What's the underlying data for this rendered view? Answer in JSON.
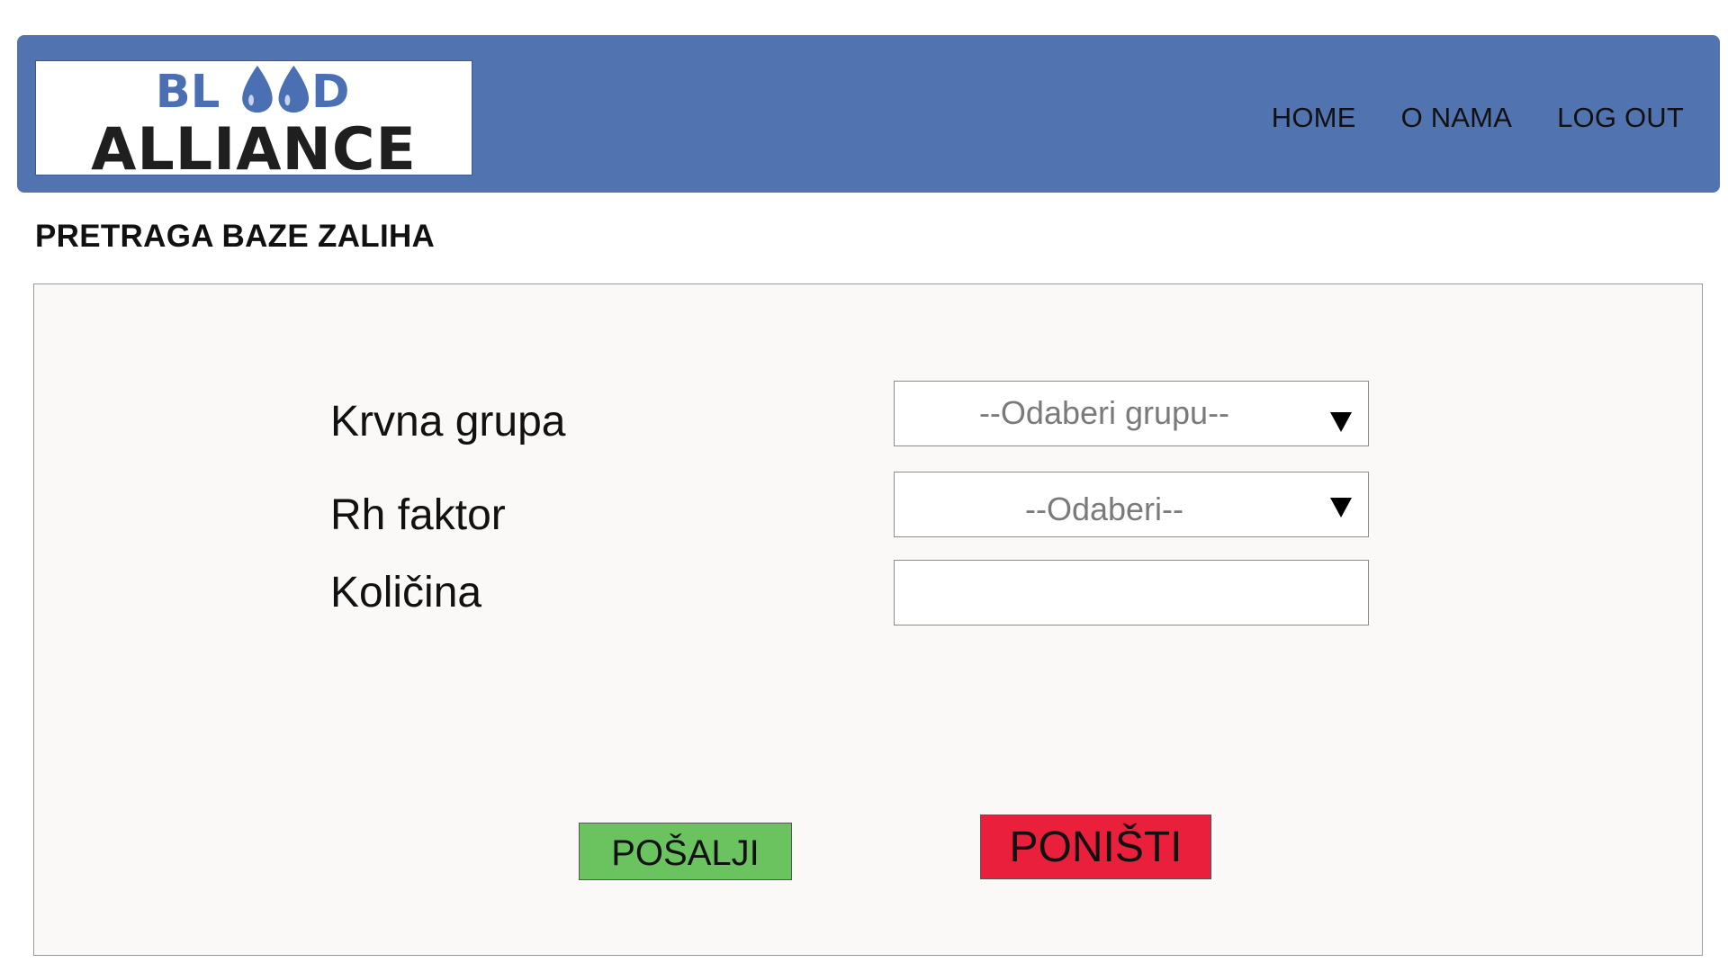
{
  "header": {
    "logo": {
      "line1": "BLOOD",
      "line2": "ALLIANCE"
    },
    "nav": [
      {
        "label": "HOME"
      },
      {
        "label": "O NAMA"
      },
      {
        "label": "LOG OUT"
      }
    ]
  },
  "page": {
    "title": "PRETRAGA BAZE ZALIHA"
  },
  "form": {
    "blood_group": {
      "label": "Krvna grupa",
      "placeholder": "--Odaberi grupu--"
    },
    "rh_factor": {
      "label": "Rh faktor",
      "placeholder": "--Odaberi--"
    },
    "quantity": {
      "label": "Količina",
      "value": ""
    },
    "buttons": {
      "submit": "POŠALJI",
      "reset": "PONIŠTI"
    }
  },
  "colors": {
    "header_bg": "#5173b0",
    "logo_blue": "#4a6fb3",
    "submit_bg": "#6ac35f",
    "reset_bg": "#ea1f3b",
    "panel_bg": "#faf9f8"
  }
}
